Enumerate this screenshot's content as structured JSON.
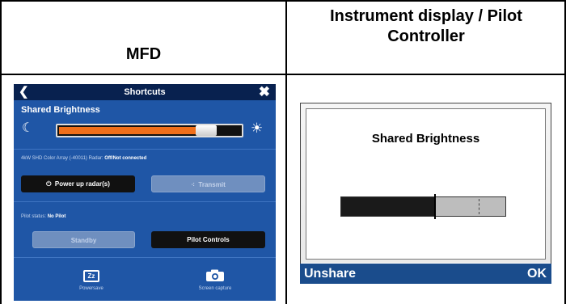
{
  "table": {
    "col1_header": "MFD",
    "col2_header": "Instrument display / Pilot Controller"
  },
  "mfd": {
    "title": "Shortcuts",
    "back_icon": "chevron-left-icon",
    "close_icon": "close-icon",
    "brightness": {
      "label": "Shared Brightness",
      "level": 0.88,
      "moon_icon": "moon-icon",
      "sun_icon": "sun-icon",
      "accent": "#f06f1a"
    },
    "radar": {
      "label": "4kW SHD Color Array (-40011) Radar:",
      "status": "Off/Not connected",
      "power_button": "Power up radar(s)",
      "transmit_button": "Transmit"
    },
    "pilot": {
      "label": "Pilot status:",
      "status": "No Pilot",
      "standby_button": "Standby",
      "controls_button": "Pilot Controls"
    },
    "powersave": {
      "label": "Powersave",
      "icon": "zz-icon"
    },
    "screen_capture": {
      "label": "Screen capture",
      "icon": "camera-icon"
    },
    "colors": {
      "background": "#1f56a6",
      "title_bar": "#08214f"
    }
  },
  "instrument": {
    "title": "Shared Brightness",
    "level": 0.57,
    "left_softkey": "Unshare",
    "right_softkey": "OK",
    "softkey_bar_color": "#1a4c8c"
  }
}
